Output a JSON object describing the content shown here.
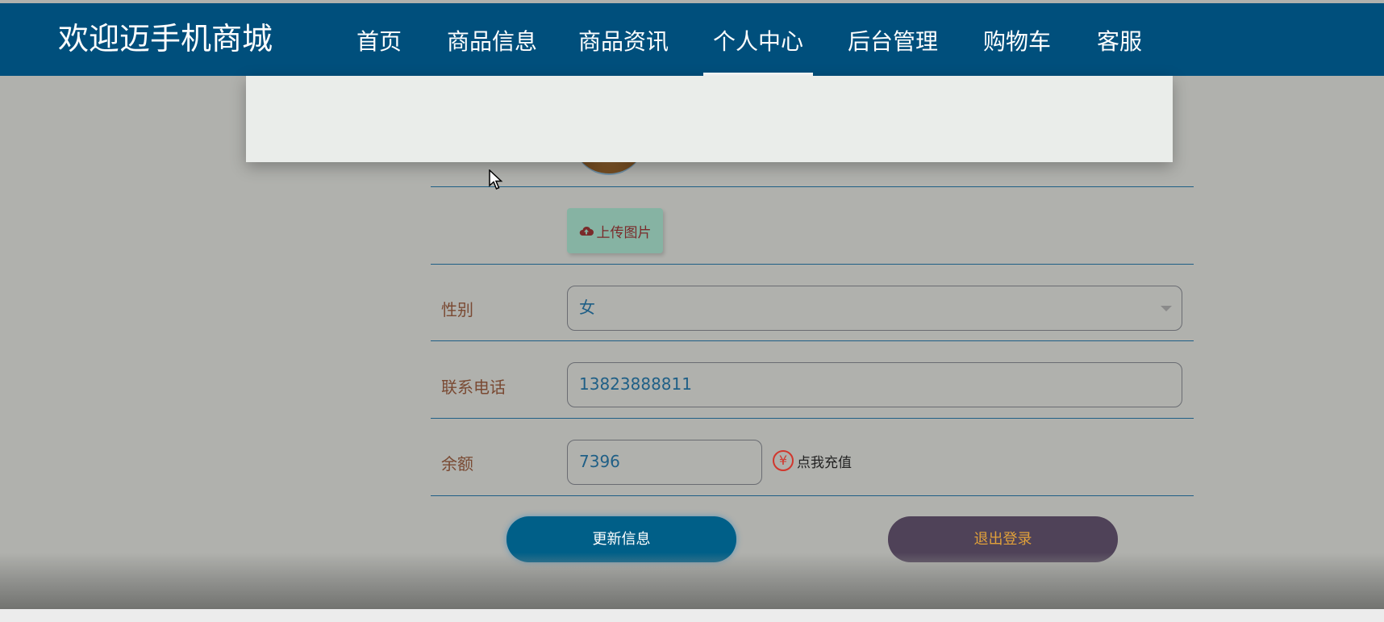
{
  "header": {
    "brand": "欢迎迈手机商城",
    "nav": [
      {
        "label": "首页"
      },
      {
        "label": "商品信息"
      },
      {
        "label": "商品资讯"
      },
      {
        "label": "个人中心",
        "active": true
      },
      {
        "label": "后台管理"
      },
      {
        "label": "购物车"
      },
      {
        "label": "客服"
      }
    ]
  },
  "form": {
    "upload_label": "上传图片",
    "gender": {
      "label": "性别",
      "value": "女"
    },
    "phone": {
      "label": "联系电话",
      "value": "13823888811"
    },
    "balance": {
      "label": "余额",
      "value": "7396",
      "recharge_label": "点我充值"
    },
    "update_button": "更新信息",
    "logout_button": "退出登录"
  },
  "colors": {
    "header_bg": "#004f7c",
    "primary_button": "#005f88",
    "logout_button": "#4f4258",
    "upload_button": "#86b3a3"
  },
  "icons": [
    "cloud-upload-icon",
    "yen-icon",
    "chevron-down-icon",
    "mouse-cursor-icon"
  ]
}
